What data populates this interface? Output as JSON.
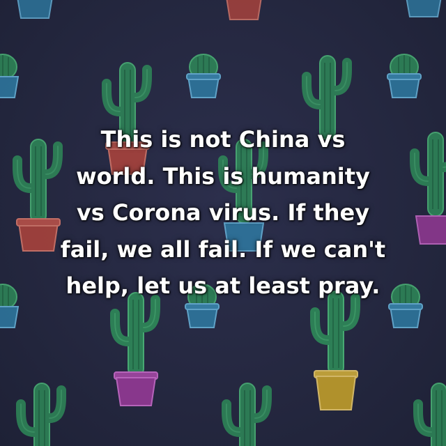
{
  "quote": {
    "lines": [
      "This is not China vs",
      "world. This is humanity",
      "vs Corona virus. If they",
      "fail, we all fail. If we can't",
      "help, let us at least pray."
    ],
    "text_color": "#ffffff"
  },
  "background": {
    "color": "#252840",
    "pattern_icon": "cactus-pot-icon",
    "cactus_color": "#2f8f5a",
    "pot_colors": [
      "#2f7fa8",
      "#b8463c",
      "#9a3a9a",
      "#c9a42a"
    ]
  }
}
